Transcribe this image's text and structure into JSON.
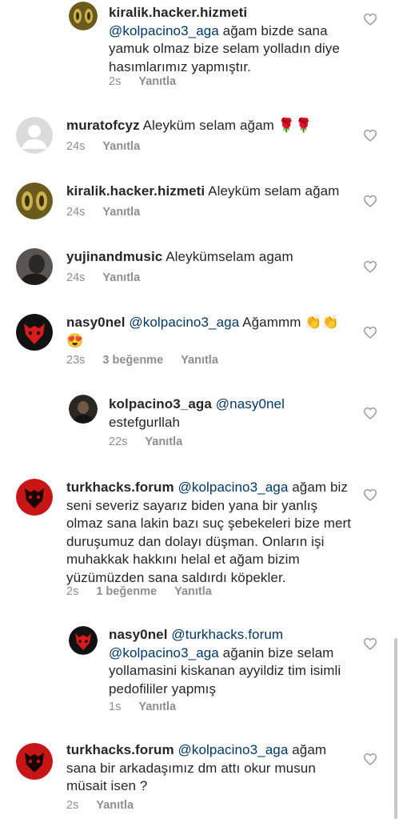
{
  "like_label": "Yanıtla",
  "comments": [
    {
      "user": "kiralik.hacker.hizmeti",
      "text_parts": [
        {
          "t": "@kolpacino3_aga",
          "m": true
        },
        {
          "t": " ağam bizde sana yamuk olmaz bize selam yolladın diye hasımlarımız yapmıştır.",
          "m": false
        }
      ],
      "time": "2s",
      "likes": "",
      "reply": "Yanıtla"
    },
    {
      "user": "muratofcyz",
      "text_parts": [
        {
          "t": "Aleyküm selam ağam 🌹🌹",
          "m": false
        }
      ],
      "time": "24s",
      "likes": "",
      "reply": "Yanıtla"
    },
    {
      "user": "kiralik.hacker.hizmeti",
      "text_parts": [
        {
          "t": "Aleyküm selam ağam",
          "m": false
        }
      ],
      "time": "24s",
      "likes": "",
      "reply": "Yanıtla"
    },
    {
      "user": "yujinandmusic",
      "text_parts": [
        {
          "t": "Aleykümselam agam",
          "m": false
        }
      ],
      "time": "24s",
      "likes": "",
      "reply": "Yanıtla"
    },
    {
      "user": "nasy0nel",
      "text_parts": [
        {
          "t": "@kolpacino3_aga",
          "m": true
        },
        {
          "t": " Ağammm 👏👏 😍",
          "m": false
        }
      ],
      "time": "23s",
      "likes": "3 beğenme",
      "reply": "Yanıtla"
    },
    {
      "user": "kolpacino3_aga",
      "text_parts": [
        {
          "t": "@nasy0nel",
          "m": true
        },
        {
          "t": " estefgurllah",
          "m": false
        }
      ],
      "time": "22s",
      "likes": "",
      "reply": "Yanıtla"
    },
    {
      "user": "turkhacks.forum",
      "text_parts": [
        {
          "t": "@kolpacino3_aga",
          "m": true
        },
        {
          "t": " ağam biz seni severiz sayarız biden yana bir yanlış olmaz sana lakin bazı suç şebekeleri bize mert duruşumuz dan dolayı düşman. Onların işi muhakkak hakkını helal et ağam bizim yüzümüzden sana saldırdı köpekler.",
          "m": false
        }
      ],
      "time": "2s",
      "likes": "1 beğenme",
      "reply": "Yanıtla"
    },
    {
      "user": "nasy0nel",
      "text_parts": [
        {
          "t": "@turkhacks.forum",
          "m": true
        },
        {
          "t": " ",
          "m": false
        },
        {
          "t": "@kolpacino3_aga",
          "m": true
        },
        {
          "t": " ağanin bize selam yollamasini kiskanan ayyildiz tim isimli pedofililer yapmış",
          "m": false
        }
      ],
      "time": "1s",
      "likes": "",
      "reply": "Yanıtla"
    },
    {
      "user": "turkhacks.forum",
      "text_parts": [
        {
          "t": "@kolpacino3_aga",
          "m": true
        },
        {
          "t": " ağam sana bir arkadaşımız dm attı okur musun müsait isen ?",
          "m": false
        }
      ],
      "time": "2s",
      "likes": "",
      "reply": "Yanıtla"
    }
  ]
}
